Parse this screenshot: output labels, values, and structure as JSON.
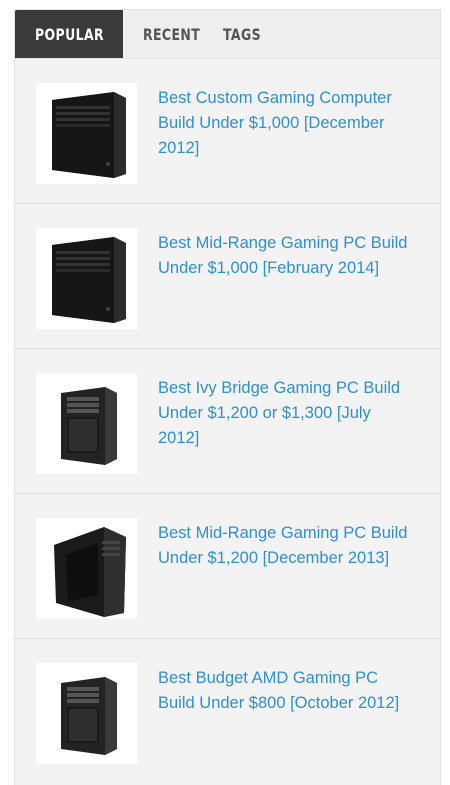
{
  "tabs": [
    {
      "label": "POPULAR",
      "active": true
    },
    {
      "label": "RECENT",
      "active": false
    },
    {
      "label": "TAGS",
      "active": false
    }
  ],
  "colors": {
    "active_tab_bg": "#3a3a3a",
    "link": "#2f8fd4",
    "panel_bg": "#f3f3f3"
  },
  "posts": [
    {
      "title": "Best Custom Gaming Computer Build Under $1,000 [December 2012]",
      "thumbnail": "pc-case-icon"
    },
    {
      "title": "Best Mid-Range Gaming PC Build Under $1,000 [February 2014]",
      "thumbnail": "pc-case-icon"
    },
    {
      "title": "Best Ivy Bridge Gaming PC Build Under $1,200 or $1,300 [July 2012]",
      "thumbnail": "pc-case-icon"
    },
    {
      "title": "Best Mid-Range Gaming PC Build Under $1,200 [December 2013]",
      "thumbnail": "pc-case-icon"
    },
    {
      "title": "Best Budget AMD Gaming PC Build Under $800 [October 2012]",
      "thumbnail": "pc-case-icon"
    }
  ]
}
